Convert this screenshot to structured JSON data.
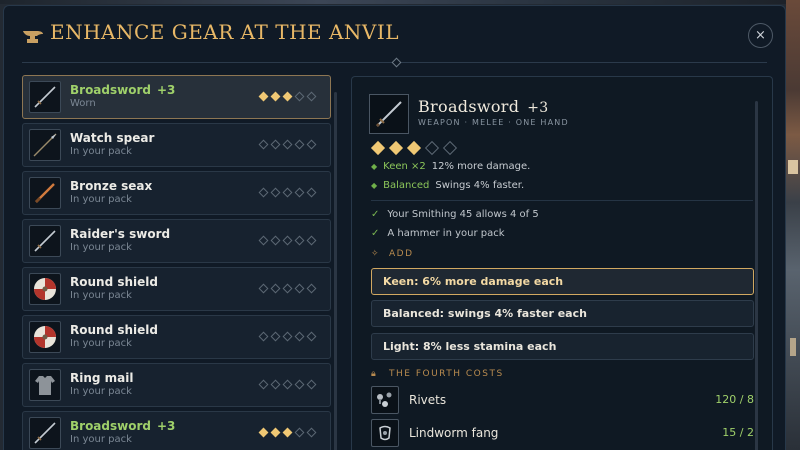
{
  "window": {
    "title": "ENHANCE GEAR AT THE ANVIL",
    "close_label": "×"
  },
  "items": [
    {
      "name": "Broadsword",
      "level": "+3",
      "sub": "Worn",
      "filled": 3,
      "total": 5,
      "icon": "sword-icon",
      "selected": true
    },
    {
      "name": "Watch spear",
      "level": "",
      "sub": "In your pack",
      "filled": 0,
      "total": 5,
      "icon": "spear-icon",
      "selected": false
    },
    {
      "name": "Bronze seax",
      "level": "",
      "sub": "In your pack",
      "filled": 0,
      "total": 5,
      "icon": "seax-icon",
      "selected": false
    },
    {
      "name": "Raider's sword",
      "level": "",
      "sub": "In your pack",
      "filled": 0,
      "total": 5,
      "icon": "sword-icon",
      "selected": false
    },
    {
      "name": "Round shield",
      "level": "",
      "sub": "In your pack",
      "filled": 0,
      "total": 5,
      "icon": "shield-icon",
      "selected": false
    },
    {
      "name": "Round shield",
      "level": "",
      "sub": "In your pack",
      "filled": 0,
      "total": 5,
      "icon": "shield-icon",
      "selected": false
    },
    {
      "name": "Ring mail",
      "level": "",
      "sub": "In your pack",
      "filled": 0,
      "total": 5,
      "icon": "mail-icon",
      "selected": false
    },
    {
      "name": "Broadsword",
      "level": "+3",
      "sub": "In your pack",
      "filled": 3,
      "total": 5,
      "icon": "sword-icon",
      "selected": false
    }
  ],
  "detail": {
    "name": "Broadsword",
    "level": "+3",
    "type": "WEAPON · MELEE · ONE HAND",
    "filled": 3,
    "total": 5,
    "traits": [
      {
        "name": "Keen ×2",
        "text": "12% more damage."
      },
      {
        "name": "Balanced",
        "text": "Swings 4% faster."
      }
    ],
    "requirements": [
      "Your Smithing 45 allows 4 of 5",
      "A hammer in your pack"
    ],
    "add_heading": "ADD",
    "options": [
      {
        "label": "Keen:  6% more damage each",
        "active": true
      },
      {
        "label": "Balanced:  swings 4% faster each",
        "active": false
      },
      {
        "label": "Light:  8% less stamina each",
        "active": false
      }
    ],
    "cost_heading": "THE FOURTH COSTS",
    "costs": [
      {
        "name": "Rivets",
        "qty": "120 / 8",
        "icon": "rivets-icon"
      },
      {
        "name": "Lindworm fang",
        "qty": "15 / 2",
        "icon": "fang-icon"
      }
    ]
  },
  "colors": {
    "accent": "#e8b867",
    "enhanced_name": "#9fd06a",
    "pip_on": "#f0c874",
    "panel": "#101a26"
  }
}
